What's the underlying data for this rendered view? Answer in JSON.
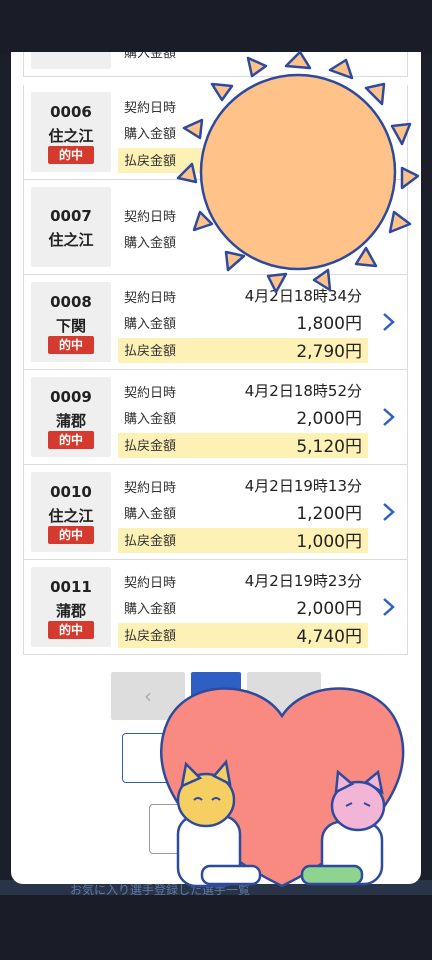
{
  "screen": {
    "background": "#1c1f2a"
  },
  "rows": [
    {
      "id": "0006",
      "venue": "住之江",
      "hit": "的中",
      "contract_label": "契約日時",
      "contract": "",
      "purchase_label": "購入金額",
      "purchase": "",
      "refund_label": "払戻金額",
      "refund": ""
    },
    {
      "id": "0007",
      "venue": "住之江",
      "hit": "",
      "contract_label": "契約日時",
      "contract": "",
      "purchase_label": "購入金額",
      "purchase": "",
      "refund_label": "",
      "refund": ""
    },
    {
      "id": "0008",
      "venue": "下関",
      "hit": "的中",
      "contract_label": "契約日時",
      "contract": "4月2日18時34分",
      "purchase_label": "購入金額",
      "purchase": "1,800円",
      "refund_label": "払戻金額",
      "refund": "2,790円"
    },
    {
      "id": "0009",
      "venue": "蒲郡",
      "hit": "的中",
      "contract_label": "契約日時",
      "contract": "4月2日18時52分",
      "purchase_label": "購入金額",
      "purchase": "2,000円",
      "refund_label": "払戻金額",
      "refund": "5,120円"
    },
    {
      "id": "0010",
      "venue": "住之江",
      "hit": "的中",
      "contract_label": "契約日時",
      "contract": "4月2日19時13分",
      "purchase_label": "購入金額",
      "purchase": "1,200円",
      "refund_label": "払戻金額",
      "refund": "1,000円"
    },
    {
      "id": "0011",
      "venue": "蒲郡",
      "hit": "的中",
      "contract_label": "契約日時",
      "contract": "4月2日19時23分",
      "purchase_label": "購入金額",
      "purchase": "2,000円",
      "refund_label": "払戻金額",
      "refund": "4,740円"
    }
  ],
  "top_partial": {
    "purchase_label": "購入金額"
  },
  "pager": {
    "prev": "‹"
  },
  "background_strip": "お気に入り選手登録した選手一覧",
  "colors": {
    "accent": "#2d5fc4",
    "badge": "#d43b2e",
    "refund_highlight": "#fdf1b6"
  },
  "stickers": [
    "sun-sticker",
    "heart-cats-sticker"
  ]
}
